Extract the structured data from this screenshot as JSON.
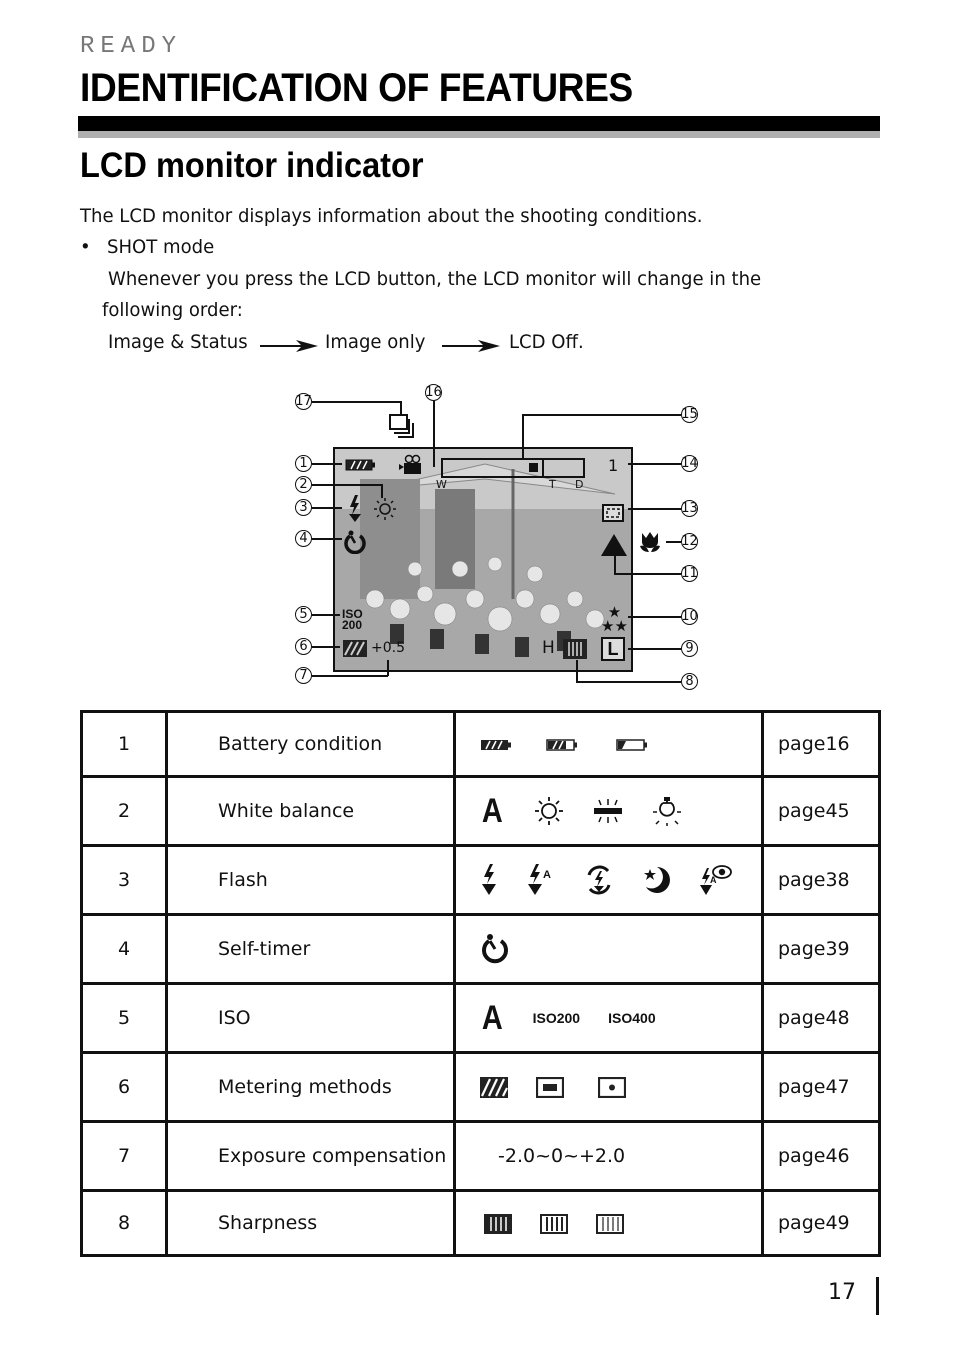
{
  "header": {
    "section": "READY",
    "title": "IDENTIFICATION OF FEATURES",
    "subtitle": "LCD monitor indicator"
  },
  "intro": {
    "paragraph": "The LCD monitor displays information about the shooting conditions.",
    "bullet": "SHOT mode",
    "line1": "Whenever you press the LCD button, the LCD monitor will change in the",
    "line2": "following order:",
    "sequence": [
      "Image & Status",
      "Image only",
      "LCD Off."
    ]
  },
  "figure": {
    "callouts": [
      "1",
      "2",
      "3",
      "4",
      "5",
      "6",
      "7",
      "8",
      "9",
      "10",
      "11",
      "12",
      "13",
      "14",
      "15",
      "16",
      "17"
    ],
    "overlay": {
      "iso_line1": "ISO",
      "iso_line2": "200",
      "exposure": "+0.5",
      "zoom_w": "W",
      "zoom_t": "T",
      "zoom_d": "D",
      "shots_remaining": "1",
      "sharpness_label": "H",
      "size_label": "L"
    },
    "icons": [
      "battery-full-icon",
      "movie-camera-icon",
      "zoom-bar-icon",
      "daylight-icon",
      "flash-icon",
      "self-timer-icon",
      "iso-icon",
      "metering-icon",
      "sharpness-icon",
      "size-icon",
      "quality-stars-icon",
      "focus-mountain-icon",
      "macro-icon",
      "af-frame-icon",
      "continuous-shot-icon"
    ]
  },
  "table": {
    "rows": [
      {
        "num": "1",
        "name": "Battery condition",
        "page": "page16",
        "icons": [
          "battery-full-icon",
          "battery-half-icon",
          "battery-low-icon"
        ]
      },
      {
        "num": "2",
        "name": "White balance",
        "page": "page45",
        "icons": [
          "auto-wb-icon",
          "daylight-icon",
          "fluorescent-icon",
          "tungsten-icon"
        ]
      },
      {
        "num": "3",
        "name": "Flash",
        "page": "page38",
        "icons": [
          "flash-on-icon",
          "flash-auto-icon",
          "flash-off-icon",
          "night-flash-icon",
          "red-eye-flash-icon"
        ]
      },
      {
        "num": "4",
        "name": "Self-timer",
        "page": "page39",
        "icons": [
          "self-timer-icon"
        ]
      },
      {
        "num": "5",
        "name": "ISO",
        "page": "page48",
        "icons": [
          "iso-auto-icon",
          "iso-200-icon",
          "iso-400-icon"
        ],
        "iso_values": [
          "A",
          "200",
          "400"
        ],
        "iso_label": "ISO"
      },
      {
        "num": "6",
        "name": "Metering methods",
        "page": "page47",
        "icons": [
          "matrix-metering-icon",
          "center-metering-icon",
          "spot-metering-icon"
        ]
      },
      {
        "num": "7",
        "name": "Exposure compensation",
        "page": "page46",
        "range_text": "-2.0~0~+2.0"
      },
      {
        "num": "8",
        "name": "Sharpness",
        "page": "page49",
        "icons": [
          "sharpness-hard-icon",
          "sharpness-normal-icon",
          "sharpness-soft-icon"
        ]
      }
    ],
    "wb_auto": "A"
  },
  "footer": {
    "page_number": "17"
  }
}
